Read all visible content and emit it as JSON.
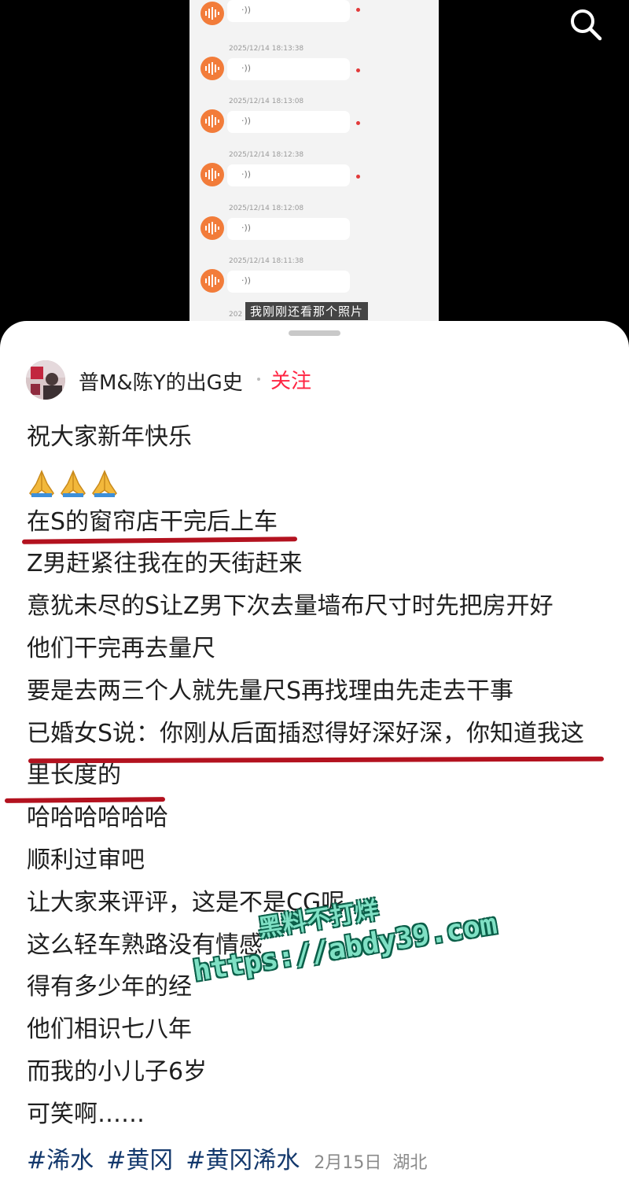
{
  "media": {
    "messages": [
      {
        "timestamp": "",
        "unread": true
      },
      {
        "timestamp": "2025/12/14 18:13:38",
        "unread": true
      },
      {
        "timestamp": "2025/12/14 18:13:08",
        "unread": true
      },
      {
        "timestamp": "2025/12/14 18:12:38",
        "unread": true
      },
      {
        "timestamp": "2025/12/14 18:12:08",
        "unread": false
      },
      {
        "timestamp": "2025/12/14 18:11:38",
        "unread": false
      }
    ],
    "last_timestamp_fragment": "202",
    "subtitle": "我刚刚还看那个照片",
    "icons": {
      "search": "search-icon",
      "voice": "voice-message-icon",
      "wave": "sound-wave-icon"
    }
  },
  "post": {
    "author": "普M&陈Y的出G史",
    "follow_label": "关注",
    "lines": [
      "祝大家新年快乐",
      "🙏🙏🙏",
      "在S的窗帘店干完后上车",
      "Z男赶紧往我在的天街赶来",
      "意犹未尽的S让Z男下次去量墙布尺寸时先把房开好",
      "他们干完再去量尺",
      "要是去两三个人就先量尺S再找理由先走去干事",
      "已婚女S说：你刚从后面插怼得好深好深，你知道我这",
      "里长度的",
      "哈哈哈哈哈哈",
      "顺利过审吧",
      "让大家来评评，这是不是CG呢",
      "这么轻车熟路没有情感",
      "得有多少年的经",
      "他们相识七八年",
      "而我的小儿子6岁",
      "可笑啊……"
    ],
    "tags": [
      "#浠水",
      "#黄冈",
      "#黄冈浠水"
    ],
    "date": "2月15日",
    "location": "湖北"
  },
  "watermark": {
    "line1": "黑料不打烊",
    "line2": "https://abdy39.com"
  },
  "colors": {
    "accent": "#ff2442",
    "tag": "#13386c",
    "underline": "#b3121f",
    "voice": "#f27c3a"
  }
}
